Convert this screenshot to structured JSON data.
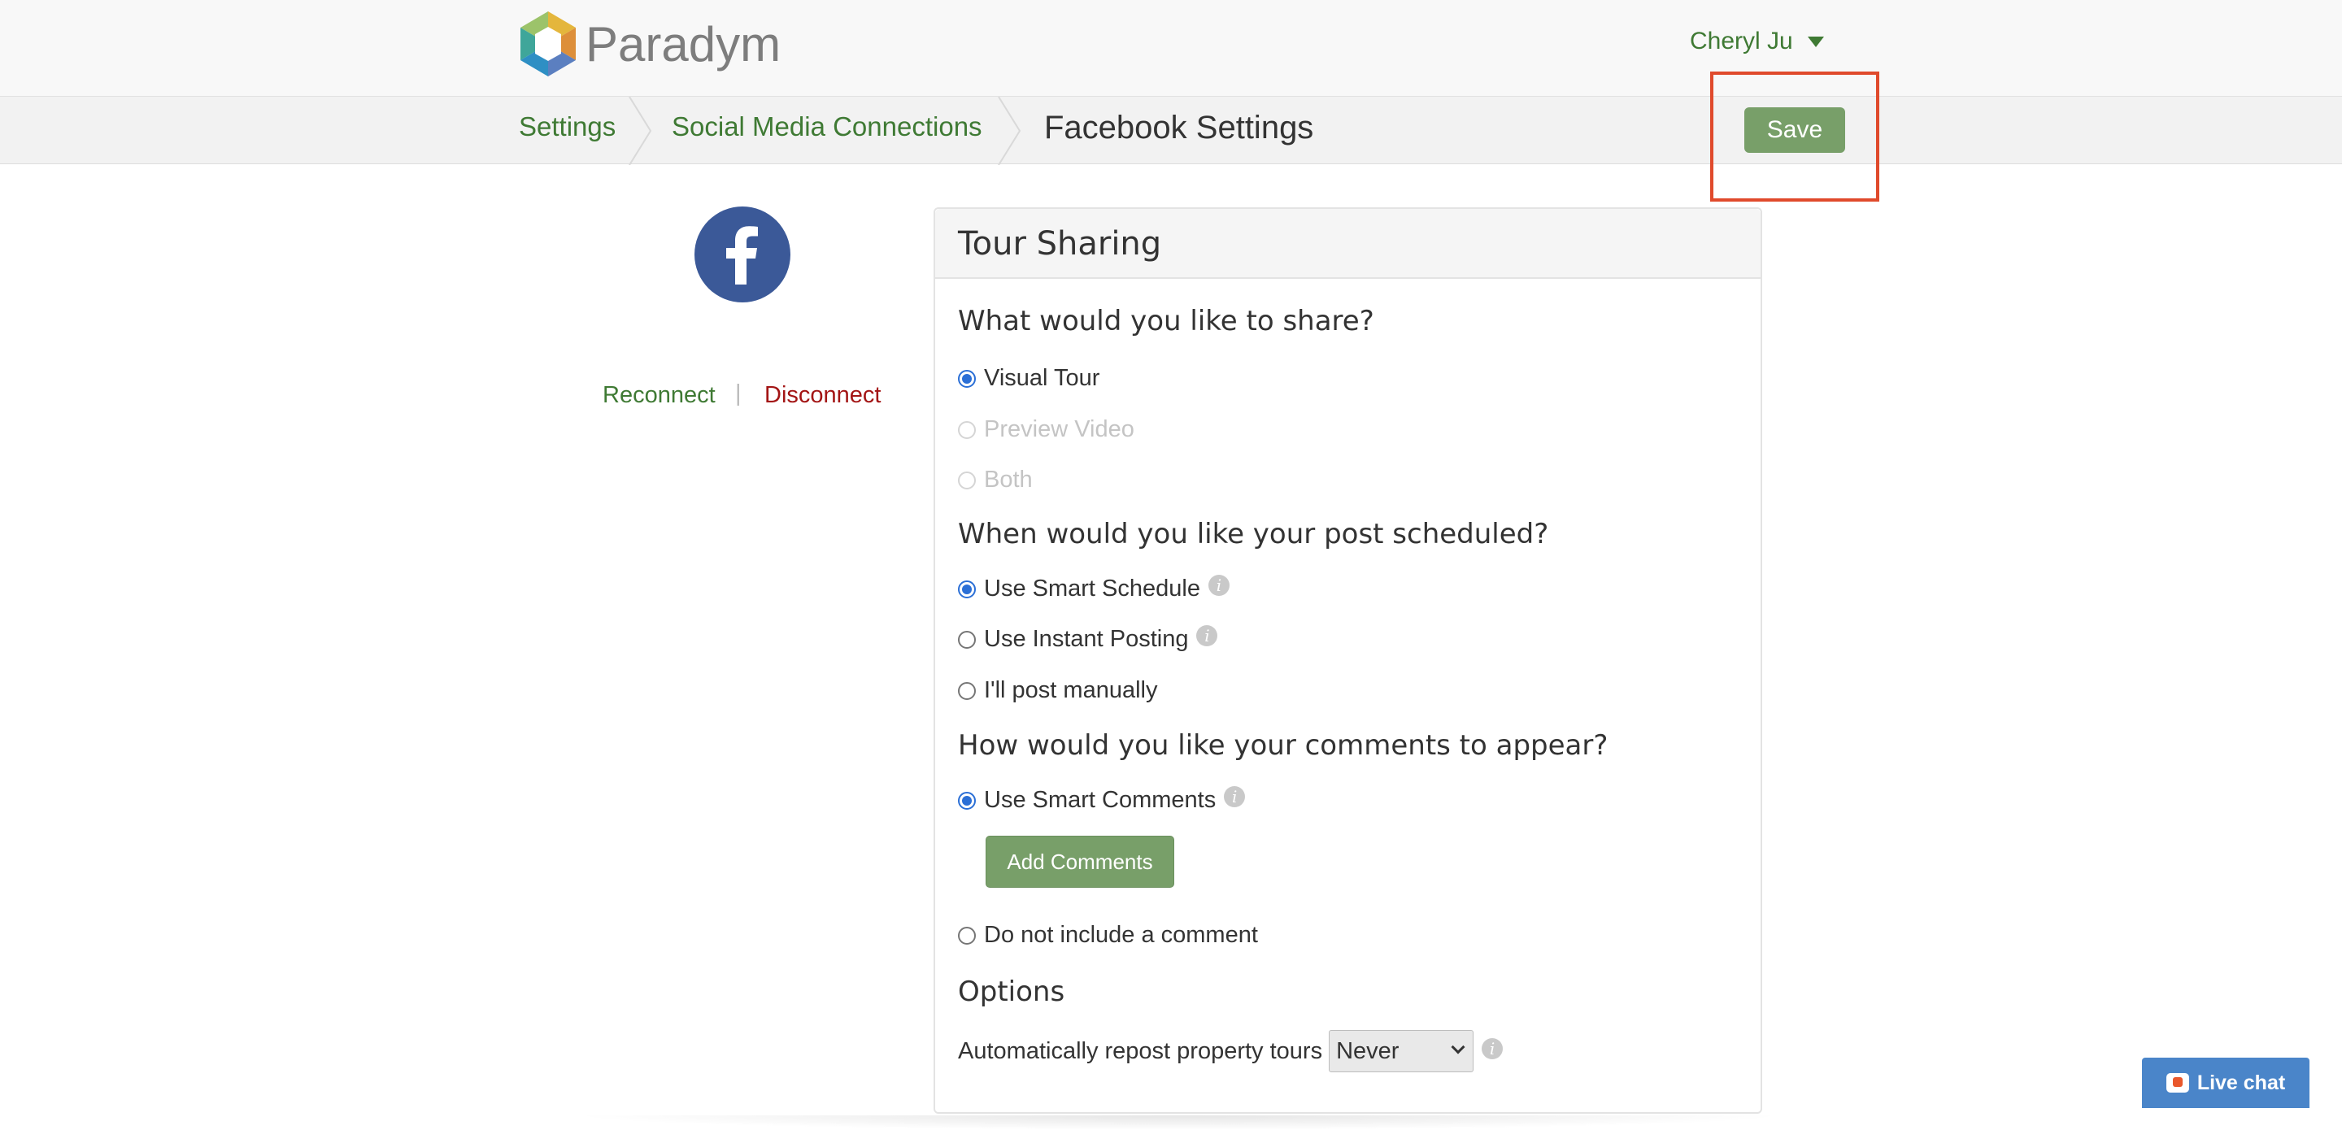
{
  "brand": {
    "name": "Paradym",
    "colors": {
      "accent_green": "#3f7a34",
      "button_green": "#789f69",
      "danger_red": "#a31515",
      "radio_blue": "#2b6fd6",
      "highlight_red": "#e04a2c",
      "livechat_blue": "#4a85c9"
    }
  },
  "header": {
    "user_name": "Cheryl Ju",
    "user_menu_icon": "caret-down-icon"
  },
  "breadcrumb": {
    "items": [
      "Settings",
      "Social Media Connections"
    ],
    "current": "Facebook Settings"
  },
  "toolbar": {
    "save_label": "Save"
  },
  "account": {
    "icon": "facebook-icon",
    "reconnect_label": "Reconnect",
    "separator": "|",
    "disconnect_label": "Disconnect"
  },
  "panel": {
    "title": "Tour Sharing",
    "share_question": "What would you like to share?",
    "share_options": [
      {
        "label": "Visual Tour",
        "checked": true,
        "disabled": false
      },
      {
        "label": "Preview Video",
        "checked": false,
        "disabled": true
      },
      {
        "label": "Both",
        "checked": false,
        "disabled": true
      }
    ],
    "schedule_question": "When would you like your post scheduled?",
    "schedule_options": [
      {
        "label": "Use Smart Schedule",
        "checked": true,
        "info": true
      },
      {
        "label": "Use Instant Posting",
        "checked": false,
        "info": true
      },
      {
        "label": "I'll post manually",
        "checked": false,
        "info": false
      }
    ],
    "comments_question": "How would you like your comments to appear?",
    "comment_options": [
      {
        "label": "Use Smart Comments",
        "checked": true,
        "info": true
      },
      {
        "label": "Do not include a comment",
        "checked": false,
        "info": false
      }
    ],
    "add_comments_label": "Add Comments",
    "options_heading": "Options",
    "repost_label": "Automatically repost property tours",
    "repost_selected": "Never",
    "info_icon": "info-icon"
  },
  "livechat": {
    "label": "Live chat",
    "icon": "chat-bubble-icon"
  }
}
